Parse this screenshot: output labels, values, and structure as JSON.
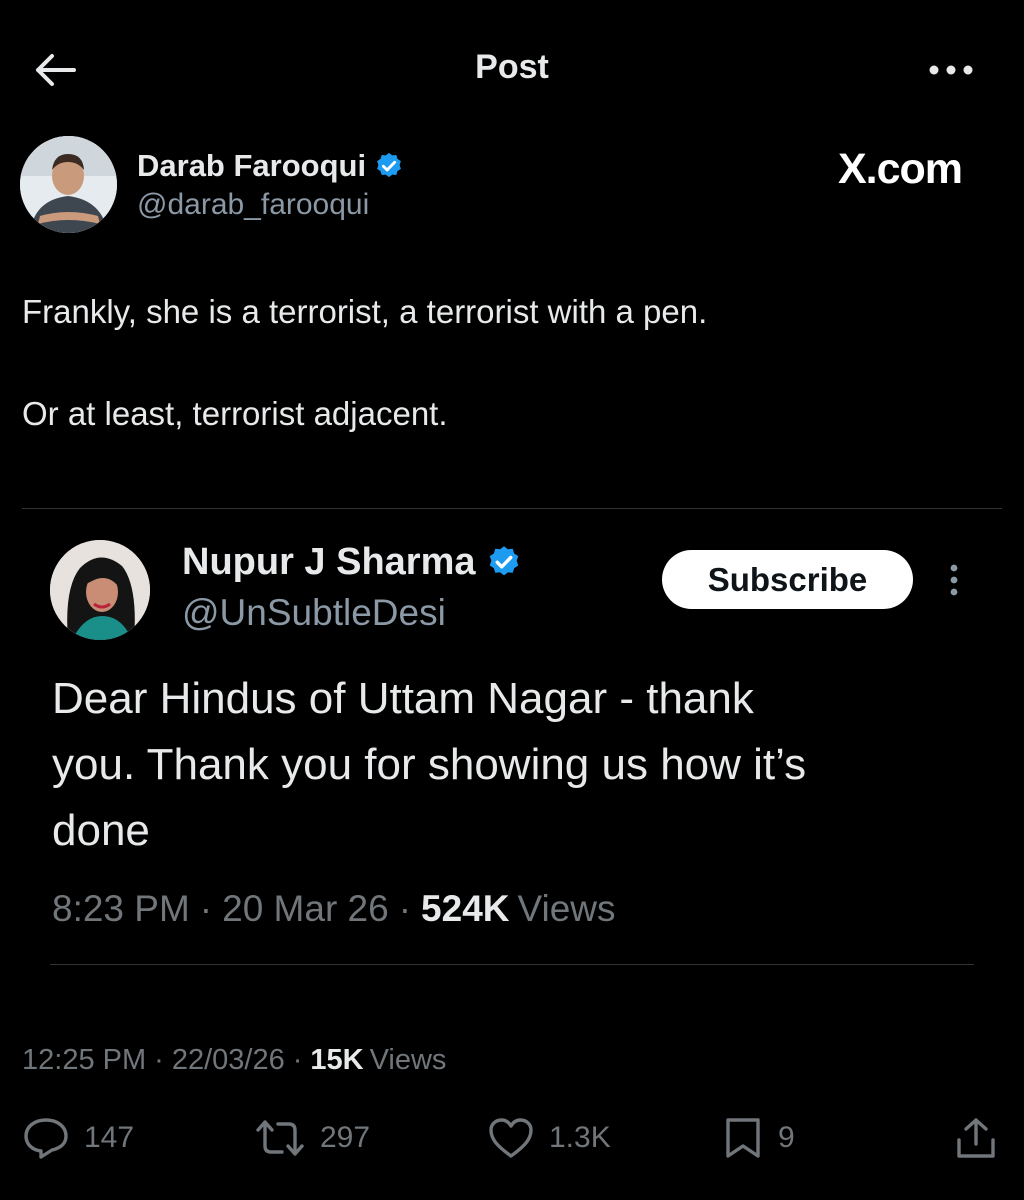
{
  "header": {
    "title": "Post",
    "back_icon": "arrow-left-icon",
    "more_icon": "more-horizontal-icon"
  },
  "post": {
    "author_name": "Darab Farooqui",
    "author_handle": "@darab_farooqui",
    "watermark": "X.com",
    "text_line1": "Frankly, she is a terrorist, a terrorist with a pen.",
    "text_line2": "Or at least, terrorist adjacent.",
    "time": "12:25 PM",
    "date": "22/03/26",
    "views_count": "15K",
    "views_label": "Views",
    "separator": "·"
  },
  "quoted": {
    "author_name": "Nupur J Sharma",
    "author_handle": "@UnSubtleDesi",
    "subscribe_label": "Subscribe",
    "text_line1": "Dear Hindus of Uttam Nagar - thank",
    "text_line2": "you. Thank you for showing us how it’s",
    "text_line3": "done",
    "time": "8:23 PM",
    "date": "20 Mar 26",
    "views_count": "524K",
    "views_label": "Views",
    "separator": "·"
  },
  "actions": {
    "replies": "147",
    "reposts": "297",
    "likes": "1.3K",
    "bookmarks": "9"
  },
  "colors": {
    "background": "#000000",
    "verified": "#1d9bf0",
    "muted": "#71767b",
    "text": "#e7e9ea"
  }
}
